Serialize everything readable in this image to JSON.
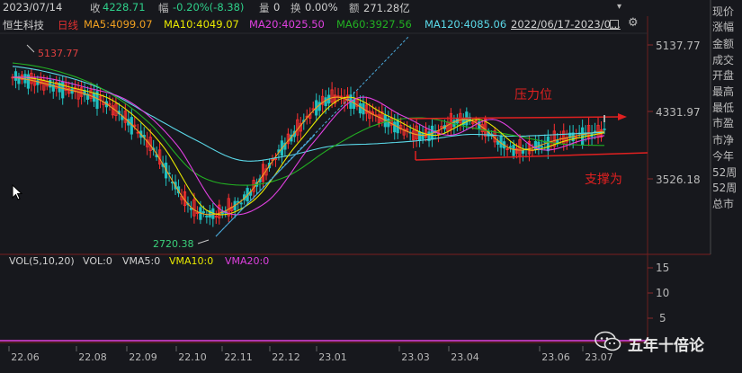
{
  "header": {
    "date": "2023/07/14",
    "close_label": "收",
    "close_value": "4228.71",
    "change_label": "幅",
    "change_value": "-0.20%(-8.38)",
    "volume_label": "量",
    "volume_value": "0",
    "turnover_label": "换",
    "turnover_value": "0.00%",
    "amount_label": "额",
    "amount_value": "271.28亿"
  },
  "legend": {
    "name": "恒生科技",
    "period": "日线",
    "ma5": "MA5:4099.07",
    "ma10": "MA10:4049.07",
    "ma20": "MA20:4025.50",
    "ma60": "MA60:3927.56",
    "ma120": "MA120:4085.06",
    "range": "2022/06/17-2023/0...",
    "colors": {
      "ma5": "#f0a020",
      "ma10": "#e8e800",
      "ma20": "#e040e0",
      "ma60": "#22b022",
      "ma120": "#5ad8e8",
      "up": "#ff3030",
      "down": "#20c0c0"
    }
  },
  "side_panel": {
    "items": [
      "现价",
      "涨幅",
      "金额",
      "成交",
      "开盘",
      "最高",
      "最低",
      "市盈",
      "市净",
      "今年",
      "52周",
      "52周",
      "总市"
    ]
  },
  "annotations": {
    "high": "5137.77",
    "low": "2720.38",
    "resistance": "压力位",
    "support": "支撑为"
  },
  "volume_legend": {
    "title": "VOL(5,10,20)",
    "vol": "VOL:0",
    "vma5": "VMA5:0",
    "vma10": "VMA10:0",
    "vma20": "VMA20:0"
  },
  "volume_axis": [
    "15",
    "10",
    "5"
  ],
  "watermark": "五年十倍论",
  "chart_data": {
    "type": "line",
    "title": "恒生科技",
    "y_ticks": [
      5137.77,
      4331.97,
      3526.18
    ],
    "ylim": [
      2720.38,
      5137.77
    ],
    "x_ticks": [
      "22.06",
      "22.08",
      "22.09",
      "22.10",
      "22.11",
      "22.12",
      "23.01",
      "23.03",
      "23.04",
      "23.06",
      "23.07"
    ],
    "x": [
      "22.06",
      "22.07",
      "22.08",
      "22.09",
      "22.10",
      "22.11",
      "22.12",
      "23.01",
      "23.02",
      "23.03",
      "23.04",
      "23.05",
      "23.06",
      "23.07"
    ],
    "series": [
      {
        "name": "MA5",
        "values": [
          4750,
          4630,
          4450,
          3950,
          3150,
          3250,
          3950,
          4500,
          4280,
          4050,
          4240,
          3880,
          4000,
          4099
        ]
      },
      {
        "name": "MA120",
        "values": [
          4880,
          4780,
          4600,
          4300,
          4000,
          3750,
          3800,
          3920,
          3950,
          3990,
          4060,
          4040,
          4060,
          4085
        ]
      },
      {
        "name": "MA60",
        "values": [
          4920,
          4820,
          4600,
          4200,
          3600,
          3450,
          3550,
          3900,
          4180,
          4260,
          4150,
          4050,
          3950,
          3928
        ]
      }
    ],
    "high": {
      "x": "22.06",
      "value": 5137.77
    },
    "low": {
      "x": "22.10",
      "value": 2720.38
    },
    "resistance_level": 4331.97,
    "support_level": 3830
  }
}
